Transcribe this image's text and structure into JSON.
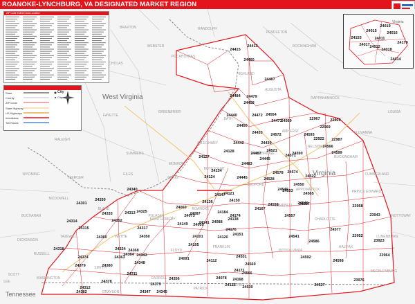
{
  "header": {
    "title": "ROANOKE-LYNCHBURG, VA DESIGNATED MARKET REGION",
    "edition": "2023 ZIP Code Redline Edition"
  },
  "legend": {
    "rows": [
      "State",
      "County",
      "ZIP Code",
      "State Highway",
      "US Highways",
      "Interstates",
      "Toll Roads"
    ],
    "city_samples": [
      "City",
      "City"
    ]
  },
  "index": {
    "heading": "ZIP Code Index/Cross Location"
  },
  "states": {
    "west_virginia": "West Virginia",
    "virginia": "Virginia",
    "tennessee": "Tennessee"
  },
  "counties": [
    "BRAXTON",
    "WEBSTER",
    "RANDOLPH",
    "PENDLETON",
    "ROCKINGHAM",
    "POCAHONTAS",
    "HIGHLAND",
    "AUGUSTA",
    "NICHOLAS",
    "FAYETTE",
    "GREENBRIER",
    "BATH",
    "RALEIGH",
    "SUMMERS",
    "MONROE",
    "ALLEGHANY",
    "ROCKBRIDGE",
    "AMHERST",
    "WYOMING",
    "MERCER",
    "GILES",
    "CRAIG",
    "BOTETOURT",
    "BEDFORD",
    "APPOMATTOX",
    "MCDOWELL",
    "BLAND",
    "TAZEWELL",
    "MONTGOMERY",
    "ROANOKE",
    "CAMPBELL",
    "CHARLOTTE",
    "BUCHANAN",
    "RUSSELL",
    "WYTHE",
    "PULASKI",
    "FLOYD",
    "FRANKLIN",
    "PITTSYLVANIA",
    "HALIFAX",
    "SMYTH",
    "CARROLL",
    "PATRICK",
    "HENRY",
    "WASHINGTON",
    "GRAYSON",
    "FLUVANNA",
    "BUCKINGHAM",
    "PRINCE EDWARD",
    "LUNENBURG",
    "MECKLENBURG",
    "NELSON",
    "LOUISA",
    "RAPPAHANNOCK",
    "CUMBERLAND",
    "NOTTOWAY",
    "SCOTT",
    "DICKENSON",
    "LEE"
  ],
  "zips": [
    "24415",
    "24413",
    "24484",
    "24460",
    "24458",
    "24442",
    "24487",
    "24445",
    "24433",
    "24445",
    "24440",
    "24479",
    "24467",
    "24473",
    "24472",
    "24439",
    "24483",
    "24450",
    "24578",
    "24553",
    "24521",
    "24572",
    "24554",
    "24550",
    "24522",
    "24574",
    "24571",
    "24566",
    "24528",
    "24569",
    "24593",
    "24599",
    "22922",
    "22967",
    "22969",
    "22920",
    "22987",
    "24590",
    "24597",
    "24565",
    "24558",
    "24557",
    "24540",
    "24541",
    "24549",
    "24577",
    "24586",
    "24592",
    "24598",
    "23958",
    "23943",
    "23952",
    "23923",
    "23964",
    "23976",
    "24527",
    "24530",
    "24531",
    "24566",
    "24569",
    "24112",
    "24127",
    "24128",
    "24124",
    "24134",
    "24147",
    "24150",
    "24167",
    "24136",
    "24060",
    "24073",
    "24087",
    "24101",
    "24149",
    "24141",
    "24138",
    "24091",
    "24105",
    "24120",
    "24151",
    "24121",
    "24174",
    "24184",
    "24176",
    "24088",
    "24055",
    "24078",
    "24112",
    "24171",
    "24168",
    "24314",
    "24315",
    "24318",
    "24301",
    "24324",
    "24350",
    "24360",
    "24363",
    "24364",
    "24368",
    "24374",
    "24379",
    "24380",
    "24382",
    "24340",
    "24343",
    "24348",
    "24333",
    "24317",
    "24313",
    "24352",
    "24325",
    "24330",
    "24312",
    "24311",
    "24379",
    "24345",
    "24347",
    "24378",
    "24356"
  ],
  "inset": {
    "label_state": "Virginia",
    "zips": [
      "24015",
      "24016",
      "24012",
      "24017",
      "24018",
      "24014",
      "24019",
      "24153",
      "24179",
      "24011"
    ]
  },
  "colors": {
    "accent": "#e3141b",
    "county_line": "#bfbfbf",
    "zip_line": "#e3141b"
  }
}
